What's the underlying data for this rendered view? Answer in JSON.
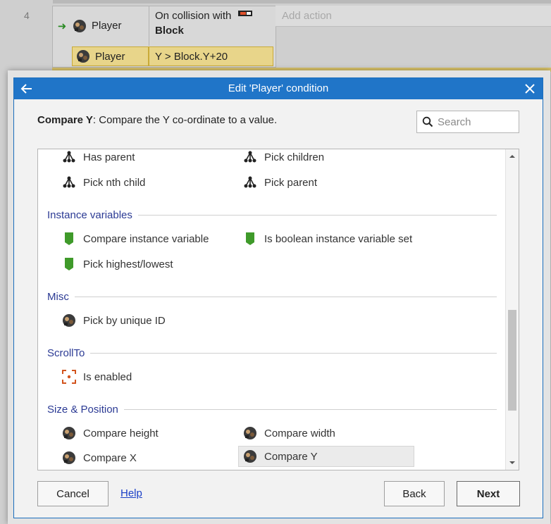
{
  "event_sheet": {
    "event_number": "4",
    "conditions": [
      {
        "object": "Player",
        "text_line1": "On collision with",
        "text_line2": "Block"
      },
      {
        "object": "Player",
        "text": "Y > Block.Y+20"
      }
    ],
    "add_action_label": "Add action"
  },
  "dialog": {
    "title": "Edit 'Player' condition",
    "description_title": "Compare Y",
    "description_text": ": Compare the Y co-ordinate to a value.",
    "search_placeholder": "Search"
  },
  "list": {
    "hierarchy_items": [
      "Has parent",
      "Pick children",
      "Pick nth child",
      "Pick parent"
    ],
    "categories": {
      "instance_variables": "Instance variables",
      "misc": "Misc",
      "scrollto": "ScrollTo",
      "size_position": "Size & Position"
    },
    "instance_variable_items": [
      "Compare instance variable",
      "Is boolean instance variable set",
      "Pick highest/lowest"
    ],
    "misc_items": [
      "Pick by unique ID"
    ],
    "scrollto_items": [
      "Is enabled"
    ],
    "size_position_items": [
      "Compare height",
      "Compare width",
      "Compare X",
      "Compare Y"
    ],
    "selected_item": "Compare Y"
  },
  "buttons": {
    "cancel": "Cancel",
    "help": "Help",
    "back": "Back",
    "next": "Next"
  },
  "colors": {
    "titlebar": "#2075c8",
    "category_text": "#2b3a94",
    "instance_var_icon": "#3f9a2a",
    "scrollto_icon": "#d2541e",
    "condition_highlight": "#e8d58a"
  }
}
